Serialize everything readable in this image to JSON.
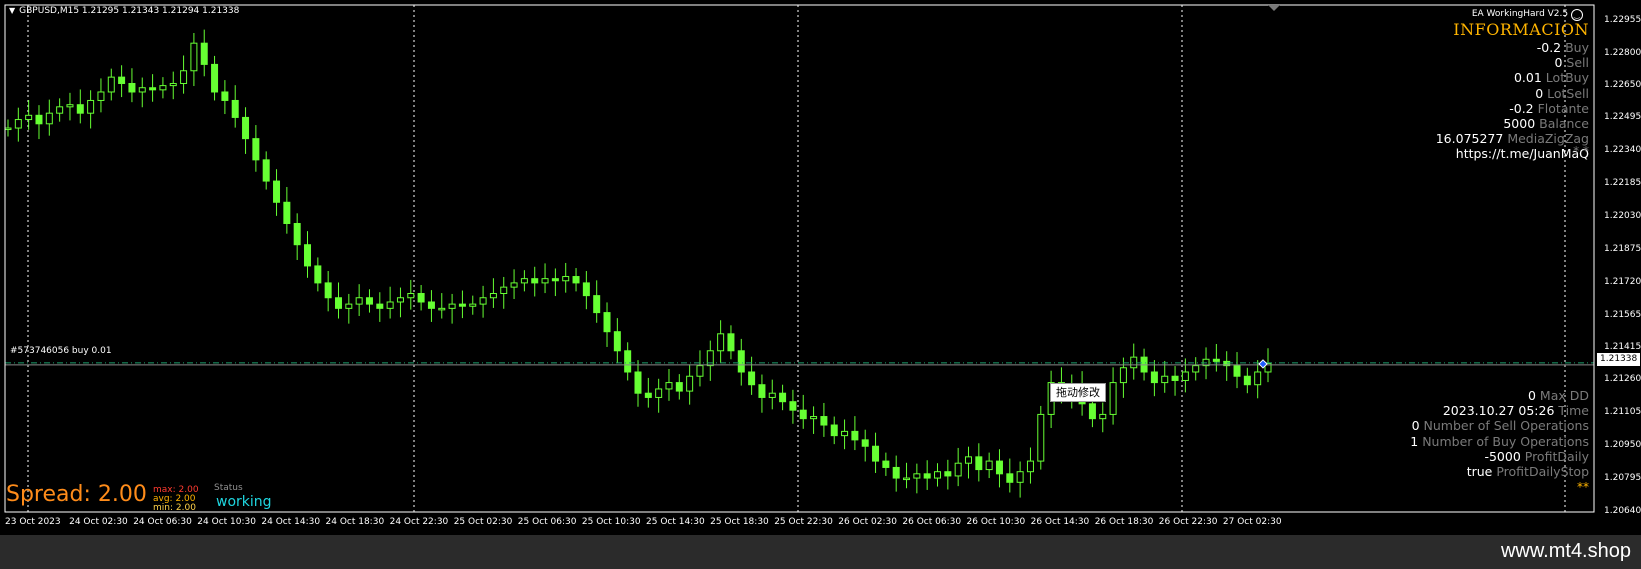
{
  "window": {
    "symbol_line": "GBPUSD,M15  1.21295 1.21343 1.21294 1.21338",
    "footer_brand": "www.mt4.shop"
  },
  "colors": {
    "candle": "#66ff33",
    "bid_line": "#8a8a8a",
    "order_line": "#1ea06e",
    "grid": "#ffffff",
    "chart_bg": "#000000"
  },
  "ea_panel": {
    "title": "EA WorkingHard V2.5",
    "smiley_icon": "smiley-icon",
    "heading": "INFORMACION",
    "rows": [
      {
        "value": "-0.2",
        "key": "Buy"
      },
      {
        "value": "0",
        "key": "Sell"
      },
      {
        "value": "0.01",
        "key": "LotBuy"
      },
      {
        "value": "0",
        "key": "LotSell"
      },
      {
        "value": "-0.2",
        "key": "Flotante"
      },
      {
        "value": "5000",
        "key": "Balance"
      },
      {
        "value": "16.075277",
        "key": "MediaZigZag"
      },
      {
        "value": "https://t.me/JuanMaQ",
        "key": ""
      }
    ],
    "stars_top": "* *",
    "bottom_rows": [
      {
        "value": "0",
        "key": "Max DD"
      },
      {
        "value": "2023.10.27 05:26",
        "key": "Time"
      },
      {
        "value": "0",
        "key": "Number of Sell Operations"
      },
      {
        "value": "1",
        "key": "Number of Buy Operations"
      },
      {
        "value": "-5000",
        "key": "ProfitDaily"
      },
      {
        "value": "true",
        "key": "ProfitDailyStop"
      }
    ],
    "stars_bottom": "**"
  },
  "drag_tooltip": "拖动修改",
  "order_label": "#573746056 buy 0.01",
  "spread": {
    "label": "Spread: 2.00",
    "max_label": "max:",
    "max_value": "2.00",
    "avg_label": "avg:",
    "avg_value": "2.00",
    "min_label": "min:",
    "min_value": "2.00"
  },
  "status": {
    "label": "Status",
    "value": "working"
  },
  "price_axis": {
    "ticks": [
      "1.22955",
      "1.22800",
      "1.22650",
      "1.22495",
      "1.22340",
      "1.22185",
      "1.22030",
      "1.21875",
      "1.21720",
      "1.21565",
      "1.21415",
      "1.21260",
      "1.21105",
      "1.20950",
      "1.20795",
      "1.20640"
    ],
    "current_price": "1.21338"
  },
  "time_axis": {
    "ticks": [
      "23 Oct 2023",
      "24 Oct 02:30",
      "24 Oct 06:30",
      "24 Oct 10:30",
      "24 Oct 14:30",
      "24 Oct 18:30",
      "24 Oct 22:30",
      "25 Oct 02:30",
      "25 Oct 06:30",
      "25 Oct 10:30",
      "25 Oct 14:30",
      "25 Oct 18:30",
      "25 Oct 22:30",
      "26 Oct 02:30",
      "26 Oct 06:30",
      "26 Oct 10:30",
      "26 Oct 14:30",
      "26 Oct 18:30",
      "26 Oct 22:30",
      "27 Oct 02:30"
    ]
  },
  "chart_data": {
    "type": "line",
    "title": "GBPUSD,M15",
    "ylim": [
      1.2064,
      1.2303
    ],
    "current_price": 1.21338,
    "order_price": 1.21338,
    "series": [
      {
        "name": "GBPUSD",
        "values": [
          1.2245,
          1.2249,
          1.2251,
          1.2247,
          1.2252,
          1.2255,
          1.2256,
          1.2252,
          1.2258,
          1.2262,
          1.2269,
          1.2266,
          1.2262,
          1.2264,
          1.2263,
          1.2265,
          1.2266,
          1.2272,
          1.2285,
          1.2275,
          1.2262,
          1.2258,
          1.225,
          1.224,
          1.223,
          1.222,
          1.221,
          1.22,
          1.219,
          1.218,
          1.2172,
          1.2165,
          1.216,
          1.2162,
          1.2165,
          1.2162,
          1.216,
          1.2163,
          1.2165,
          1.2167,
          1.2163,
          1.216,
          1.216,
          1.2162,
          1.2161,
          1.2162,
          1.2165,
          1.2167,
          1.217,
          1.2172,
          1.2174,
          1.2172,
          1.2174,
          1.2173,
          1.2175,
          1.2172,
          1.2166,
          1.2158,
          1.2149,
          1.214,
          1.213,
          1.212,
          1.2118,
          1.2122,
          1.2125,
          1.2121,
          1.2128,
          1.2133,
          1.214,
          1.2148,
          1.214,
          1.213,
          1.2124,
          1.2118,
          1.212,
          1.2116,
          1.2112,
          1.2108,
          1.2109,
          1.2105,
          1.21,
          1.2102,
          1.2098,
          1.2095,
          1.2088,
          1.2085,
          1.208,
          1.208,
          1.2082,
          1.208,
          1.2083,
          1.2081,
          1.2087,
          1.209,
          1.2084,
          1.2088,
          1.2082,
          1.2078,
          1.2083,
          1.2088,
          1.211,
          1.2125,
          1.212,
          1.2124,
          1.2115,
          1.2108,
          1.211,
          1.2125,
          1.2132,
          1.2137,
          1.213,
          1.2125,
          1.2128,
          1.2126,
          1.213,
          1.2133,
          1.2136,
          1.2135,
          1.2133,
          1.2128,
          1.2124,
          1.213,
          1.2134
        ]
      }
    ]
  }
}
